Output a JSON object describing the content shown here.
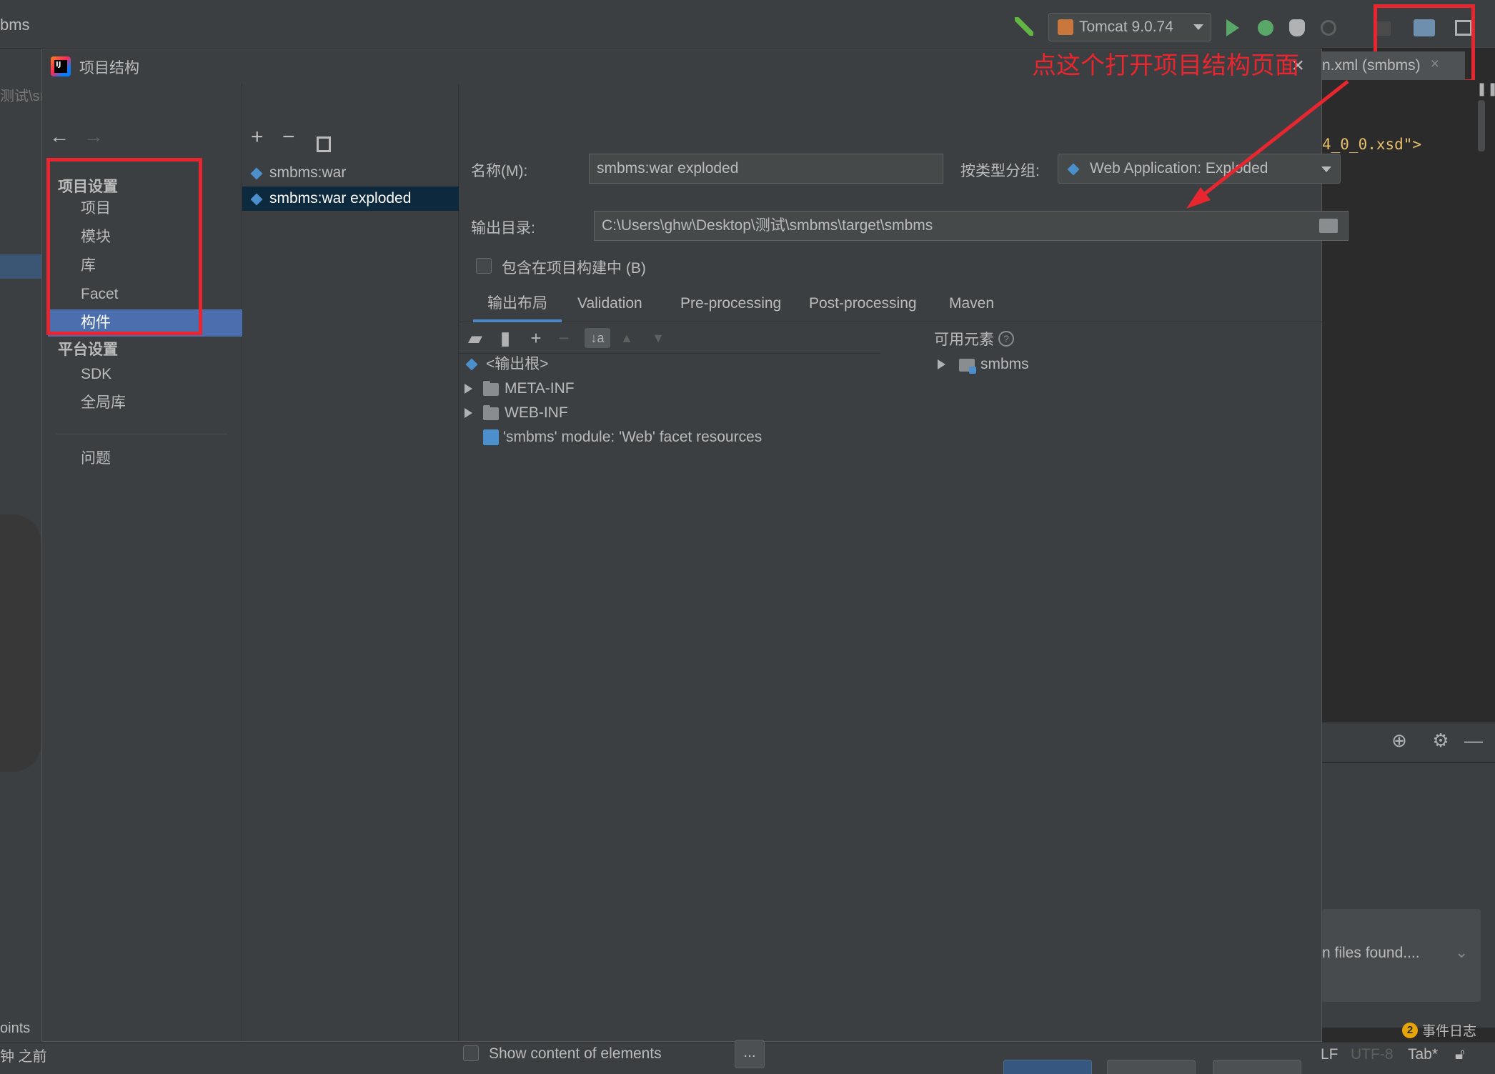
{
  "ide": {
    "title_fragment": "bms",
    "run_config": "Tomcat 9.0.74",
    "editor_tab": "n.xml (smbms)",
    "editor_tab_close": "×",
    "code_fragment": "4_0_0.xsd\">",
    "notification_text": "n files found....",
    "event_log_count": "2",
    "event_log_label": "事件日志",
    "status_lf": "LF",
    "status_encoding": "UTF-8",
    "status_indent": "Tab*",
    "left_strip": {
      "path_fragment": "测试\\sı",
      "points_fragment": "oints",
      "time_fragment": "钟 之前"
    }
  },
  "annotation": {
    "text": "点这个打开项目结构页面",
    "color": "#e8262f"
  },
  "dialog": {
    "title": "项目结构",
    "close": "×",
    "sidebar": {
      "section_project": "项目设置",
      "items_project": [
        "项目",
        "模块",
        "库",
        "Facet",
        "构件"
      ],
      "selected": "构件",
      "section_platform": "平台设置",
      "items_platform": [
        "SDK",
        "全局库"
      ],
      "problems": "问题"
    },
    "artifacts": {
      "add": "+",
      "remove": "−",
      "items": [
        "smbms:war",
        "smbms:war exploded"
      ],
      "selected": "smbms:war exploded"
    },
    "form": {
      "name_label": "名称(M):",
      "name_value": "smbms:war exploded",
      "type_label": "按类型分组:",
      "type_value": "Web Application: Exploded",
      "output_label": "输出目录:",
      "output_value": "C:\\Users\\ghw\\Desktop\\测试\\smbms\\target\\smbms",
      "include_build_label": "包含在项目构建中 (B)",
      "include_build_checked": false
    },
    "tabs": [
      "输出布局",
      "Validation",
      "Pre-processing",
      "Post-processing",
      "Maven"
    ],
    "active_tab": "输出布局",
    "output_tree": [
      {
        "label": "<输出根>",
        "expandable": false
      },
      {
        "label": "META-INF",
        "expandable": true
      },
      {
        "label": "WEB-INF",
        "expandable": true
      },
      {
        "label": "'smbms' module: 'Web' facet resources",
        "expandable": false
      }
    ],
    "available": {
      "header": "可用元素",
      "help": "?",
      "items": [
        "smbms"
      ]
    },
    "show_content_label": "Show content of elements",
    "show_content_checked": false,
    "ellipsis": "..."
  },
  "colors": {
    "selection_blue": "#4b6eaf",
    "red_highlight": "#e8262f",
    "background": "#3c3f41"
  }
}
